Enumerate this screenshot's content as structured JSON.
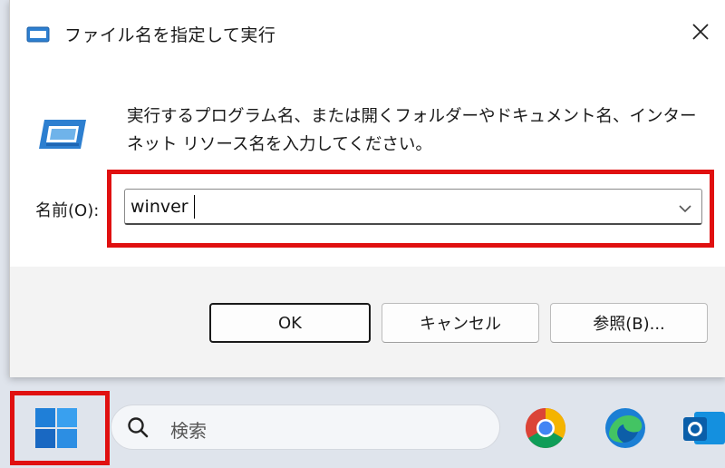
{
  "dialog": {
    "title": "ファイル名を指定して実行",
    "description_line1": "実行するプログラム名、または開くフォルダーやドキュメント名、インター",
    "description_line2": "ネット リソース名を入力してください。",
    "name_label": "名前(O):",
    "name_value": "winver",
    "buttons": {
      "ok": "OK",
      "cancel": "キャンセル",
      "browse": "参照(B)..."
    },
    "close_icon": "close-icon",
    "run_icon": "run-dialog-icon"
  },
  "taskbar": {
    "search_placeholder": "検索",
    "start_icon": "windows-start-icon",
    "apps": [
      "chrome-icon",
      "edge-icon",
      "outlook-icon"
    ]
  },
  "colors": {
    "highlight": "#e01010",
    "accent": "#0067c0",
    "taskbar_bg": "#dfe4ec"
  }
}
